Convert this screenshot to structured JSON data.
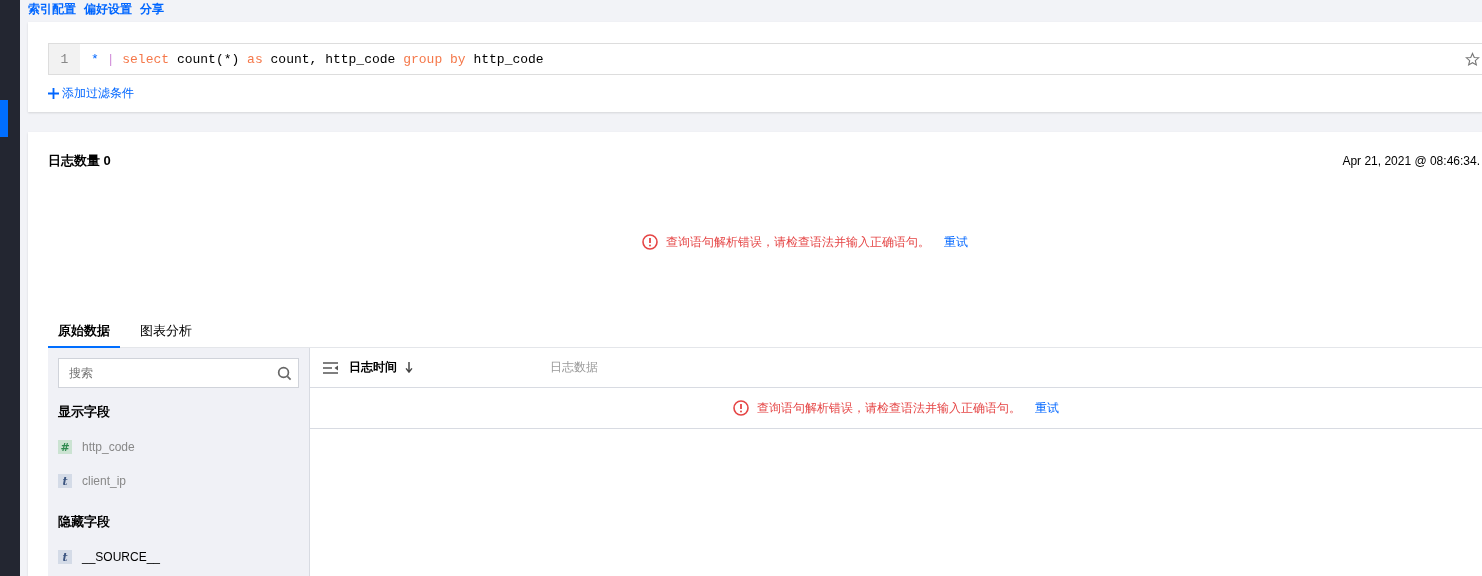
{
  "top_links": [
    "索引配置",
    "偏好设置",
    "分享"
  ],
  "query": {
    "line_number": "1",
    "tokens": [
      {
        "kind": "operator",
        "text": "*"
      },
      {
        "kind": "pipe",
        "text": "|"
      },
      {
        "kind": "keyword",
        "text": "select"
      },
      {
        "kind": "plain",
        "text": "count(*)"
      },
      {
        "kind": "keyword",
        "text": "as"
      },
      {
        "kind": "plain",
        "text": "count,"
      },
      {
        "kind": "plain",
        "text": "http_code"
      },
      {
        "kind": "keyword",
        "text": "group"
      },
      {
        "kind": "keyword",
        "text": "by"
      },
      {
        "kind": "plain",
        "text": "http_code"
      }
    ],
    "add_filter": "添加过滤条件"
  },
  "summary": {
    "title": "日志数量 0",
    "timestamp": "Apr 21, 2021 @ 08:46:34.",
    "error": "查询语句解析错误，请检查语法并输入正确语句。",
    "retry": "重试"
  },
  "tabs": [
    {
      "label": "原始数据",
      "selected": true
    },
    {
      "label": "图表分析",
      "selected": false
    }
  ],
  "sidebar": {
    "search": {
      "placeholder": "搜索"
    },
    "sections": [
      {
        "title": "显示字段",
        "fields": [
          {
            "kind": "number",
            "badge": "#",
            "name": "http_code"
          },
          {
            "kind": "text",
            "badge": "t",
            "name": "client_ip"
          }
        ]
      },
      {
        "title": "隐藏字段",
        "fields": [
          {
            "kind": "text",
            "badge": "t",
            "name": "__SOURCE__"
          }
        ]
      }
    ]
  },
  "table": {
    "columns": [
      "日志时间",
      "日志数据"
    ],
    "error": "查询语句解析错误，请检查语法并输入正确语句。",
    "retry": "重试"
  }
}
